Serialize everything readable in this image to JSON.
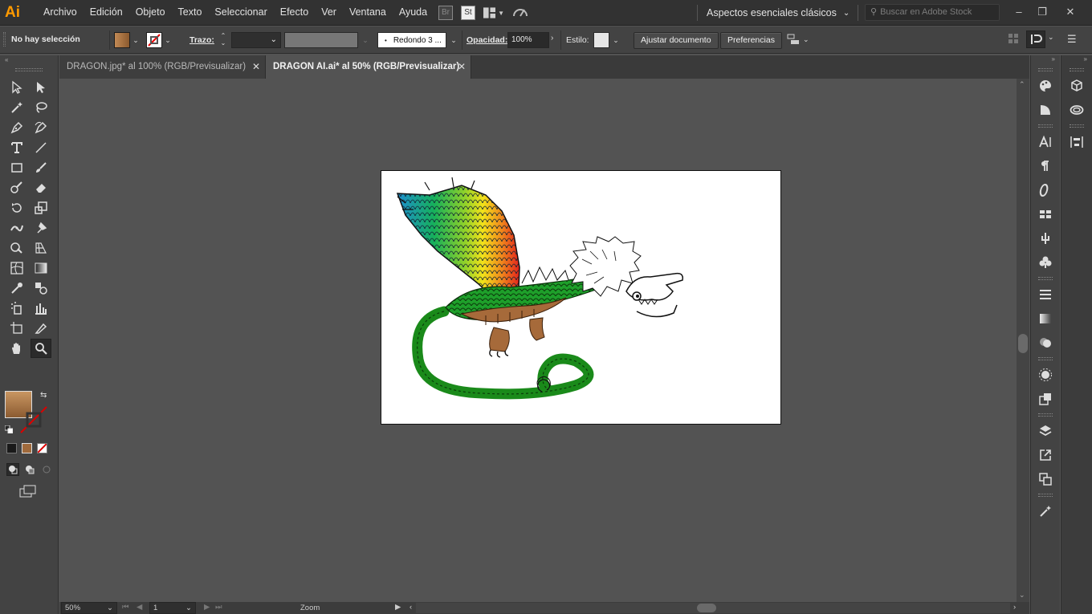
{
  "app": {
    "logo": "Ai",
    "accent": "#ff9a00"
  },
  "menu": [
    "Archivo",
    "Edición",
    "Objeto",
    "Texto",
    "Seleccionar",
    "Efecto",
    "Ver",
    "Ventana",
    "Ayuda"
  ],
  "menubar_icons": {
    "br": "Br",
    "st": "St"
  },
  "workspace": {
    "label": "Aspectos esenciales clásicos"
  },
  "search": {
    "placeholder": "Buscar en Adobe Stock"
  },
  "window_controls": {
    "minimize": "–",
    "restore": "❐",
    "close": "✕"
  },
  "control_bar": {
    "selection": "No hay selección",
    "fill_color": "#a06a3c",
    "stroke_label": "Trazo:",
    "brush": "Redondo 3 ...",
    "opacity_label": "Opacidad:",
    "opacity_value": "100%",
    "style_label": "Estilo:",
    "fit_document": "Ajustar documento",
    "preferences": "Preferencias"
  },
  "tabs": [
    {
      "label": "DRAGON.jpg* al 100% (RGB/Previsualizar)",
      "active": false
    },
    {
      "label": "DRAGON AI.ai* al 50% (RGB/Previsualizar)",
      "active": true
    }
  ],
  "tab_close": "✕",
  "status": {
    "zoom": "50%",
    "page": "1",
    "tool": "Zoom"
  },
  "tools": [
    "selection-icon",
    "direct-selection-icon",
    "magic-wand-icon",
    "lasso-icon",
    "pen-icon",
    "curvature-icon",
    "type-icon",
    "line-icon",
    "rectangle-icon",
    "paintbrush-icon",
    "shaper-icon",
    "eraser-icon",
    "rotate-icon",
    "scale-icon",
    "width-icon",
    "puppet-warp-icon",
    "shape-builder-icon",
    "perspective-grid-icon",
    "mesh-icon",
    "gradient-icon",
    "eyedropper-icon",
    "blend-icon",
    "symbol-sprayer-icon",
    "column-graph-icon",
    "artboard-icon",
    "slice-icon",
    "hand-icon",
    "zoom-icon"
  ],
  "colors": {
    "fill": "#a06a3c",
    "ui_dark": "#323232",
    "panel": "#434343",
    "canvas": "#535353"
  }
}
